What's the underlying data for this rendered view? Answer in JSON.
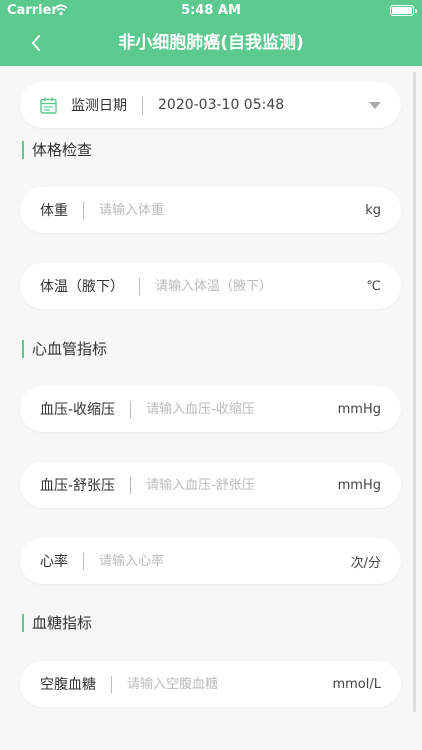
{
  "status_bar": {
    "carrier": "Carrier",
    "time": "5:48 AM"
  },
  "nav": {
    "title": "非小细胞肺癌(自我监测)"
  },
  "monitor_date": {
    "label": "监测日期",
    "value": "2020-03-10 05:48"
  },
  "sections": {
    "physical": {
      "title": "体格检查"
    },
    "cardio": {
      "title": "心血管指标"
    },
    "glucose": {
      "title": "血糖指标"
    }
  },
  "fields": {
    "weight": {
      "label": "体重",
      "placeholder": "请输入体重",
      "value": "",
      "unit": "kg"
    },
    "temperature": {
      "label": "体温（腋下）",
      "placeholder": "请输入体温（腋下）",
      "value": "",
      "unit": "℃"
    },
    "systolic": {
      "label": "血压-收缩压",
      "placeholder": "请输入血压-收缩压",
      "value": "",
      "unit": "mmHg"
    },
    "diastolic": {
      "label": "血压-舒张压",
      "placeholder": "请输入血压-舒张压",
      "value": "",
      "unit": "mmHg"
    },
    "heart_rate": {
      "label": "心率",
      "placeholder": "请输入心率",
      "value": "",
      "unit": "次/分"
    },
    "fasting_glucose": {
      "label": "空腹血糖",
      "placeholder": "请输入空腹血糖",
      "value": "",
      "unit": "mmol/L"
    }
  },
  "colors": {
    "accent": "#5cc98f",
    "background": "#f7f7f7",
    "card": "#ffffff",
    "placeholder": "#bbbbbb"
  }
}
